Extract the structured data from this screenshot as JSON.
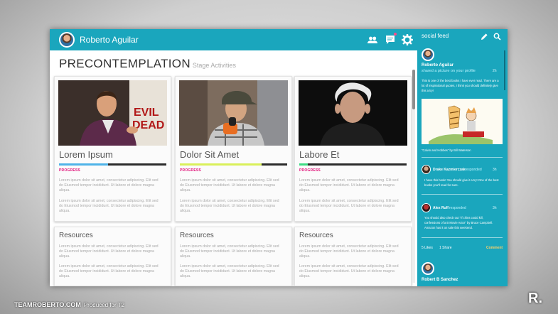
{
  "header": {
    "username": "Roberto Aguilar"
  },
  "page": {
    "title": "PRECONTEMPLATION",
    "subtitle": "Stage Activities"
  },
  "cards": [
    {
      "title": "Lorem Ipsum",
      "progress_label": "PROGRESS",
      "progress": 0.46,
      "bar_color": "#4fb3e8",
      "para1": "Lorem ipsum dolor sit amet, consectetur adipiscing. Elit sed do Eiusmod tempor incididunt. Ut labore et dolore magna aliqua.",
      "para2": "Lorem ipsum dolor sit amet, consectetur adipiscing. Elit sed do Eiusmod tempor incididunt. Ut labore et dolore magna aliqua."
    },
    {
      "title": "Dolor Sit Amet",
      "progress_label": "PROGRESS",
      "progress": 0.76,
      "bar_color": "#d9f05a",
      "para1": "Lorem ipsum dolor sit amet, consectetur adipiscing. Elit sed do Eiusmod tempor incididunt. Ut labore et dolore magna aliqua.",
      "para2": "Lorem ipsum dolor sit amet, consectetur adipiscing. Elit sed do Eiusmod tempor incididunt. Ut labore et dolore magna aliqua."
    },
    {
      "title": "Labore Et",
      "progress_label": "PROGRESS",
      "progress": 0.08,
      "bar_color": "#3ddc84",
      "para1": "Lorem ipsum dolor sit amet, consectetur adipiscing. Elit sed do Eiusmod tempor incididunt. Ut labore et dolore magna aliqua.",
      "para2": "Lorem ipsum dolor sit amet, consectetur adipiscing. Elit sed do Eiusmod tempor incididunt. Ut labore et dolore magna aliqua."
    }
  ],
  "resources": [
    {
      "title": "Resources",
      "para1": "Lorem ipsum dolor sit amet, consectetur adipiscing. Elit sed do Eiusmod tempor incididunt. Ut labore et dolore magna aliqua.",
      "para2": "Lorem ipsum dolor sit amet, consectetur adipiscing. Elit sed do Eiusmod tempor incididunt. Ut labore et dolore magna aliqua."
    },
    {
      "title": "Resources",
      "para1": "Lorem ipsum dolor sit amet, consectetur adipiscing. Elit sed do Eiusmod tempor incididunt. Ut labore et dolore magna aliqua.",
      "para2": "Lorem ipsum dolor sit amet, consectetur adipiscing. Elit sed do Eiusmod tempor incididunt. Ut labore et dolore magna aliqua."
    },
    {
      "title": "Resources",
      "para1": "Lorem ipsum dolor sit amet, consectetur adipiscing. Elit sed do Eiusmod tempor incididunt. Ut labore et dolore magna aliqua.",
      "para2": "Lorem ipsum dolor sit amet, consectetur adipiscing. Elit sed do Eiusmod tempor incididunt. Ut labore et dolore magna aliqua."
    }
  ],
  "feed": {
    "title": "social feed",
    "post1": {
      "name": "Roberto Aguilar",
      "action": "shared a picture on your profile",
      "time": "2h",
      "text": "This is one of the best books I have ever read. There are a lot of inspirational quotes, I think you should definitely give this a try!",
      "caption": "\"Calvin and Hobbes\" by Bill Waterson"
    },
    "comment1": {
      "name": "Drake Kazmierczak",
      "action": "responded",
      "time": "3h",
      "text": "I have this book! You should give it a try! One of the best books you'll read for sure."
    },
    "comment2": {
      "name": "Alex Ruff",
      "action": "responded",
      "time": "3h",
      "text": "You should also check out \"If chins could kill, confessions of a B Movie Actor\" by Bruce Campbell. Amazon has it on sale this weekend."
    },
    "likes": "5 Likes",
    "share": "1 Share",
    "comment": "Comment",
    "post2": {
      "name": "Robert B Sanchez"
    }
  },
  "footer": {
    "brand": "TEAMROBERTO.COM",
    "produced": "Produced for T2",
    "logo": "R."
  },
  "colors": {
    "accent": "#1aa6bd",
    "progress_label": "#e0147a"
  },
  "icons": [
    "users-icon",
    "chat-icon",
    "gear-icon",
    "pencil-icon",
    "search-icon"
  ]
}
